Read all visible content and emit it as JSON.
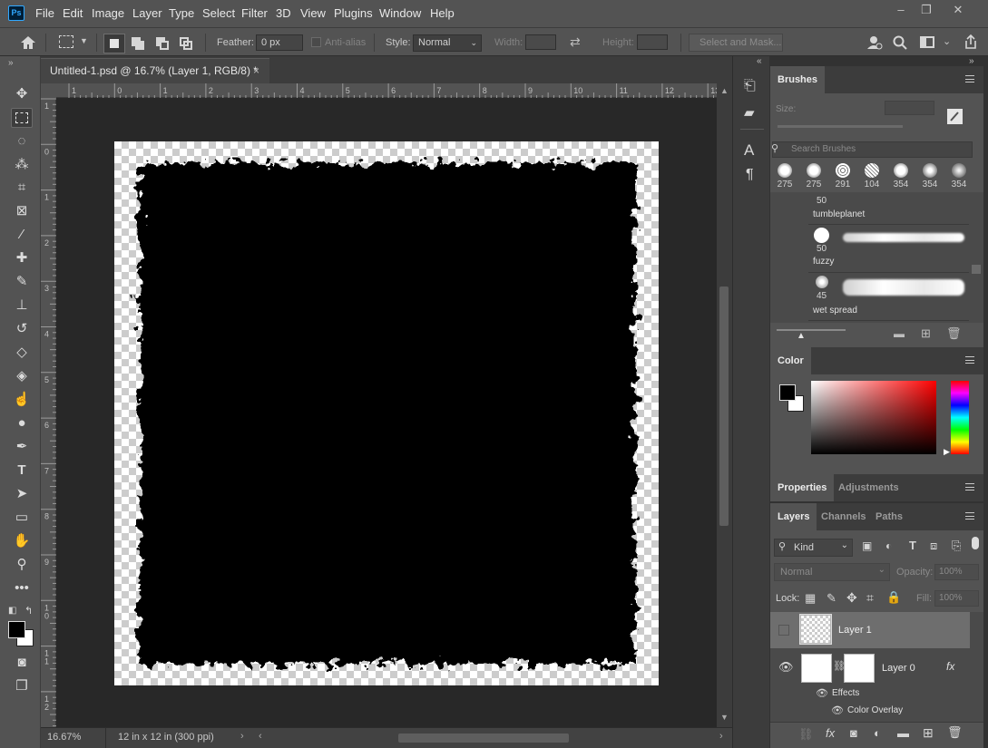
{
  "app": {
    "logo": "Ps"
  },
  "menu": [
    "File",
    "Edit",
    "Image",
    "Layer",
    "Type",
    "Select",
    "Filter",
    "3D",
    "View",
    "Plugins",
    "Window",
    "Help"
  ],
  "window_controls": {
    "minimize": "–",
    "restore": "❐",
    "close": "✕"
  },
  "options": {
    "feather_label": "Feather:",
    "feather_value": "0 px",
    "antialias_label": "Anti-alias",
    "style_label": "Style:",
    "style_value": "Normal",
    "width_label": "Width:",
    "height_label": "Height:",
    "select_mask": "Select and Mask..."
  },
  "document": {
    "tab_title": "Untitled-1.psd @ 16.7% (Layer 1, RGB/8) *",
    "close": "×"
  },
  "rulers": {
    "top": [
      "1",
      "0",
      "1",
      "2",
      "3",
      "4",
      "5",
      "6",
      "7",
      "8",
      "9",
      "10",
      "11",
      "12",
      "13"
    ],
    "left": [
      "1",
      "0",
      "1",
      "2",
      "3",
      "4",
      "5",
      "6",
      "7",
      "8",
      "9",
      "1 0",
      "1 1",
      "1 2"
    ]
  },
  "status": {
    "zoom": "16.67%",
    "doc_size": "12 in x 12 in (300 ppi)"
  },
  "brushes": {
    "tab": "Brushes",
    "size_label": "Size:",
    "search_placeholder": "Search Brushes",
    "presets": [
      "275",
      "275",
      "291",
      "104",
      "354",
      "354",
      "354"
    ],
    "list": [
      {
        "size": "50",
        "name": "tumbleplanet"
      },
      {
        "size": "50",
        "name": "fuzzy"
      },
      {
        "size": "45",
        "name": "wet spread"
      }
    ]
  },
  "color": {
    "tab": "Color",
    "fg": "#000000",
    "bg": "#ffffff",
    "hue_colors": "#ff0000"
  },
  "properties": {
    "tabs": [
      "Properties",
      "Adjustments"
    ]
  },
  "layers": {
    "tabs": [
      "Layers",
      "Channels",
      "Paths"
    ],
    "kind": "Kind",
    "blend": "Normal",
    "opacity_label": "Opacity:",
    "opacity_value": "100%",
    "lock_label": "Lock:",
    "fill_label": "Fill:",
    "fill_value": "100%",
    "items": [
      {
        "name": "Layer 1"
      },
      {
        "name": "Layer 0",
        "fx": "fx",
        "effects": "Effects",
        "effect": "Color Overlay"
      }
    ]
  }
}
